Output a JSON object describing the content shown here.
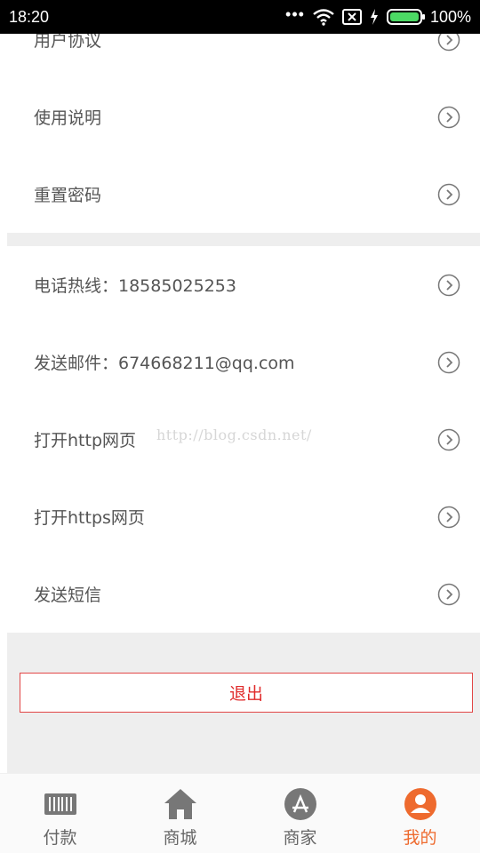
{
  "status_bar": {
    "time": "18:20",
    "battery": "100%"
  },
  "menu": {
    "items_top": [
      {
        "label": "用户协议"
      },
      {
        "label": "使用说明"
      },
      {
        "label": "重置密码"
      }
    ],
    "items_bottom": [
      {
        "label": "电话热线：18585025253"
      },
      {
        "label": "发送邮件：674668211@qq.com"
      },
      {
        "label": "打开http网页"
      },
      {
        "label": "打开https网页"
      },
      {
        "label": "发送短信"
      }
    ]
  },
  "watermark": "http://blog.csdn.net/",
  "logout_label": "退出",
  "tabbar": {
    "tabs": [
      {
        "label": "付款",
        "icon": "barcode-icon"
      },
      {
        "label": "商城",
        "icon": "home-icon"
      },
      {
        "label": "商家",
        "icon": "app-store-icon"
      },
      {
        "label": "我的",
        "icon": "user-icon"
      }
    ],
    "active": "我的"
  },
  "colors": {
    "accent": "#ee6a2e",
    "logout": "#e02c2c",
    "background_band": "#eeeeee"
  }
}
